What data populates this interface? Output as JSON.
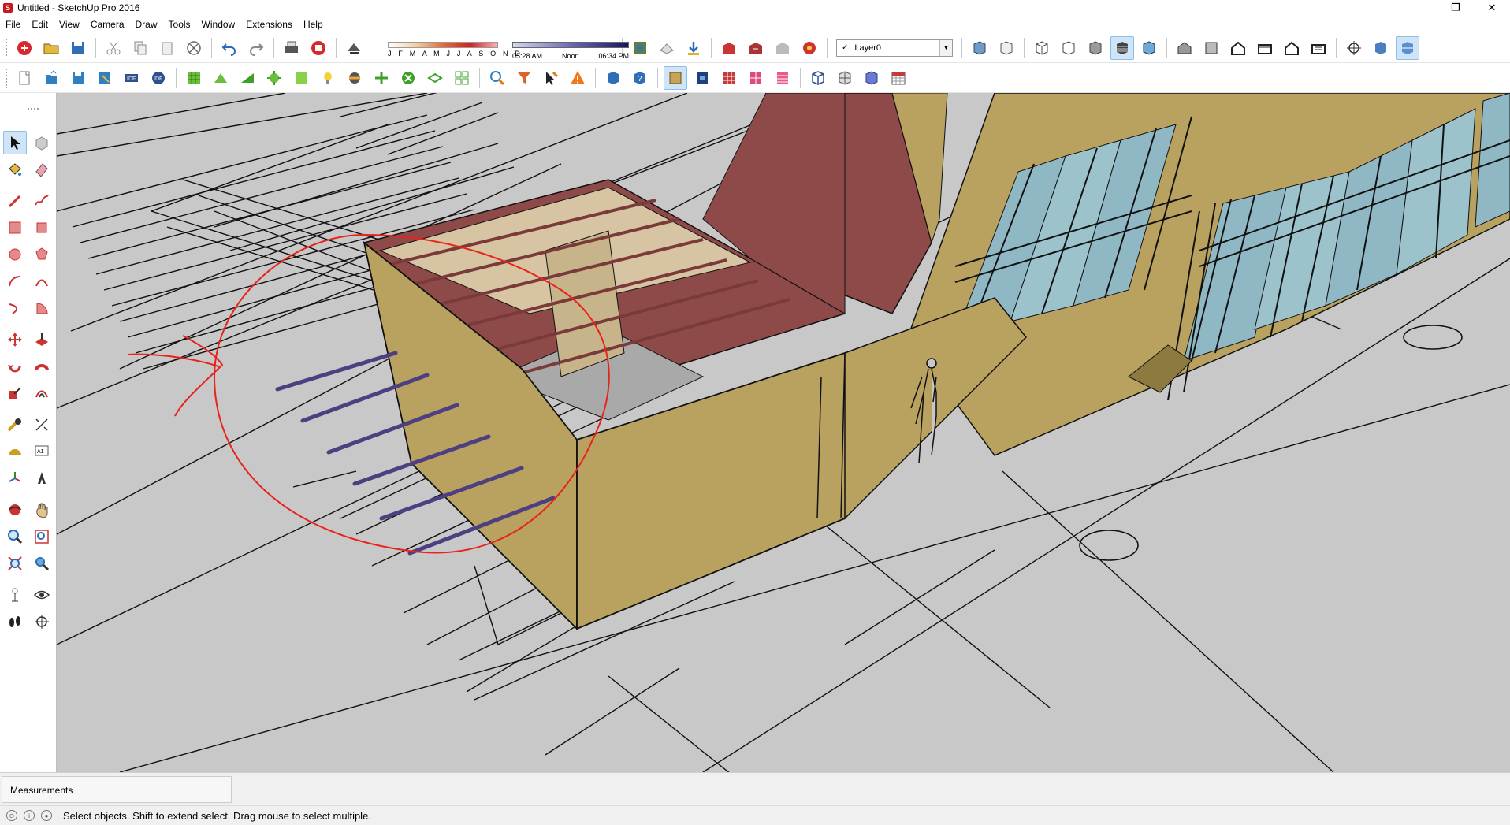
{
  "window": {
    "title": "Untitled - SketchUp Pro 2016",
    "minimize_icon": "minimize-icon",
    "restore_icon": "restore-icon",
    "close_icon": "close-icon"
  },
  "menu": [
    "File",
    "Edit",
    "View",
    "Camera",
    "Draw",
    "Tools",
    "Window",
    "Extensions",
    "Help"
  ],
  "shadows": {
    "months": "J F M A M J J A S O N D",
    "time_start": "05:28 AM",
    "time_noon": "Noon",
    "time_end": "06:34 PM"
  },
  "layer": {
    "current": "Layer0"
  },
  "measurements": {
    "label": "Measurements",
    "value": ""
  },
  "status": {
    "hint": "Select objects. Shift to extend select. Drag mouse to select multiple."
  },
  "colors": {
    "viewport_bg": "#c8c8c8",
    "wall": "#b8a25e",
    "roof": "#8e4a48",
    "glass": "#8fb7c4",
    "annotation": "#e8231c",
    "purple_bar": "#5a4b8a"
  }
}
